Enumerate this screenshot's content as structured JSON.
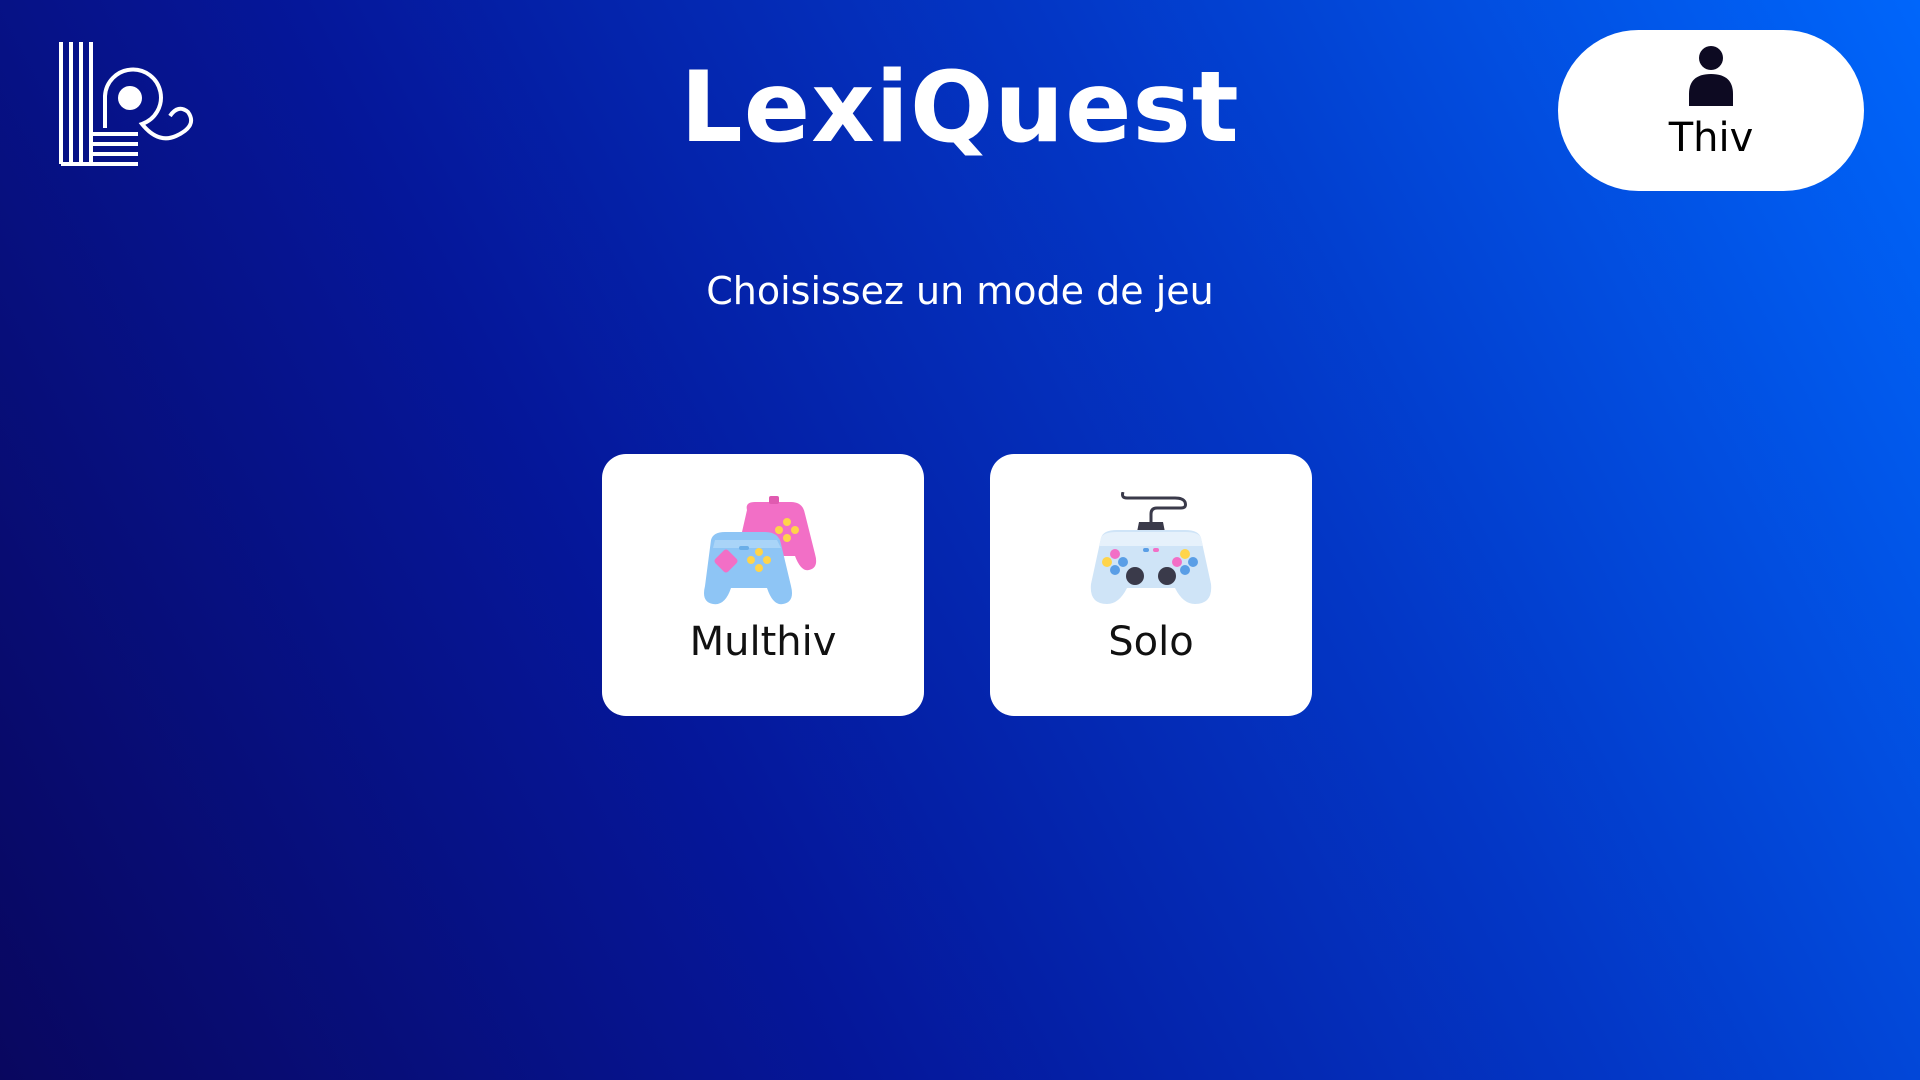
{
  "app": {
    "title": "LexiQuest",
    "logo_icon": "lexiquest-logo-icon"
  },
  "user": {
    "name": "Thiv",
    "icon": "user-icon"
  },
  "main": {
    "subtitle": "Choisissez un mode de jeu",
    "modes": [
      {
        "label": "Multhiv",
        "icon": "two-gamepads-icon"
      },
      {
        "label": "Solo",
        "icon": "gamepad-icon"
      }
    ]
  },
  "colors": {
    "background_gradient": [
      "#09075f",
      "#05179a",
      "#0337c6",
      "#0066fb"
    ],
    "card_background": "#ffffff",
    "text_on_background": "#ffffff",
    "card_text": "#111111"
  }
}
